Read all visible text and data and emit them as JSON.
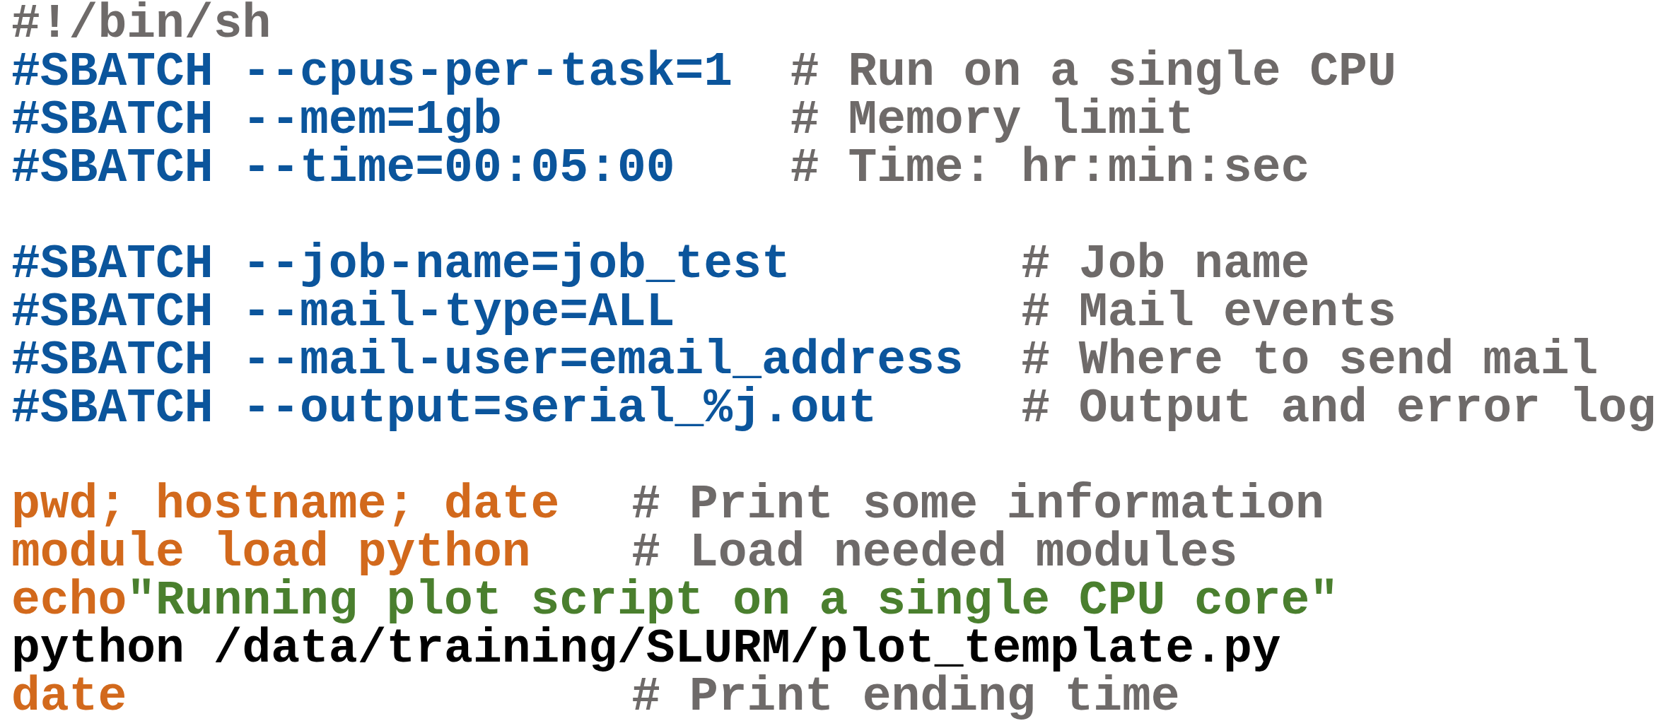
{
  "blocks": [
    {
      "lines": [
        {
          "code": [
            {
              "kind": "comment",
              "text": "#!/bin/sh"
            }
          ]
        },
        {
          "code": [
            {
              "kind": "directive",
              "text": "#SBATCH --cpus-per-task=1"
            }
          ],
          "comment": "# Run on a single CPU"
        },
        {
          "code": [
            {
              "kind": "directive",
              "text": "#SBATCH --mem=1gb"
            }
          ],
          "comment": "# Memory limit"
        },
        {
          "code": [
            {
              "kind": "directive",
              "text": "#SBATCH --time=00:05:00"
            }
          ],
          "comment": "# Time: hr:min:sec"
        }
      ]
    },
    {
      "lines": [
        {
          "code": [
            {
              "kind": "directive",
              "text": "#SBATCH --job-name=job_test"
            }
          ],
          "comment": "# Job name"
        },
        {
          "code": [
            {
              "kind": "directive",
              "text": "#SBATCH --mail-type=ALL"
            }
          ],
          "comment": "# Mail events"
        },
        {
          "code": [
            {
              "kind": "directive",
              "text": "#SBATCH --mail-user=email_address"
            }
          ],
          "comment": "# Where to send mail"
        },
        {
          "code": [
            {
              "kind": "directive",
              "text": "#SBATCH --output=serial_%j.out"
            }
          ],
          "comment": "# Output and error log"
        }
      ]
    },
    {
      "lines": [
        {
          "code": [
            {
              "kind": "command",
              "text": "pwd; hostname; date"
            }
          ],
          "comment": "# Print some information"
        },
        {
          "code": [
            {
              "kind": "command",
              "text": "module load python"
            }
          ],
          "comment": "# Load needed modules"
        },
        {
          "code": [
            {
              "kind": "command",
              "text": "echo"
            },
            {
              "kind": "string",
              "text": "\"Running plot script on a single CPU core\""
            }
          ]
        },
        {
          "code": [
            {
              "kind": "plain",
              "text": "python /data/training/SLURM/plot_template.py"
            }
          ]
        },
        {
          "code": [
            {
              "kind": "command",
              "text": "date"
            }
          ],
          "comment": "# Print ending time"
        }
      ]
    }
  ]
}
